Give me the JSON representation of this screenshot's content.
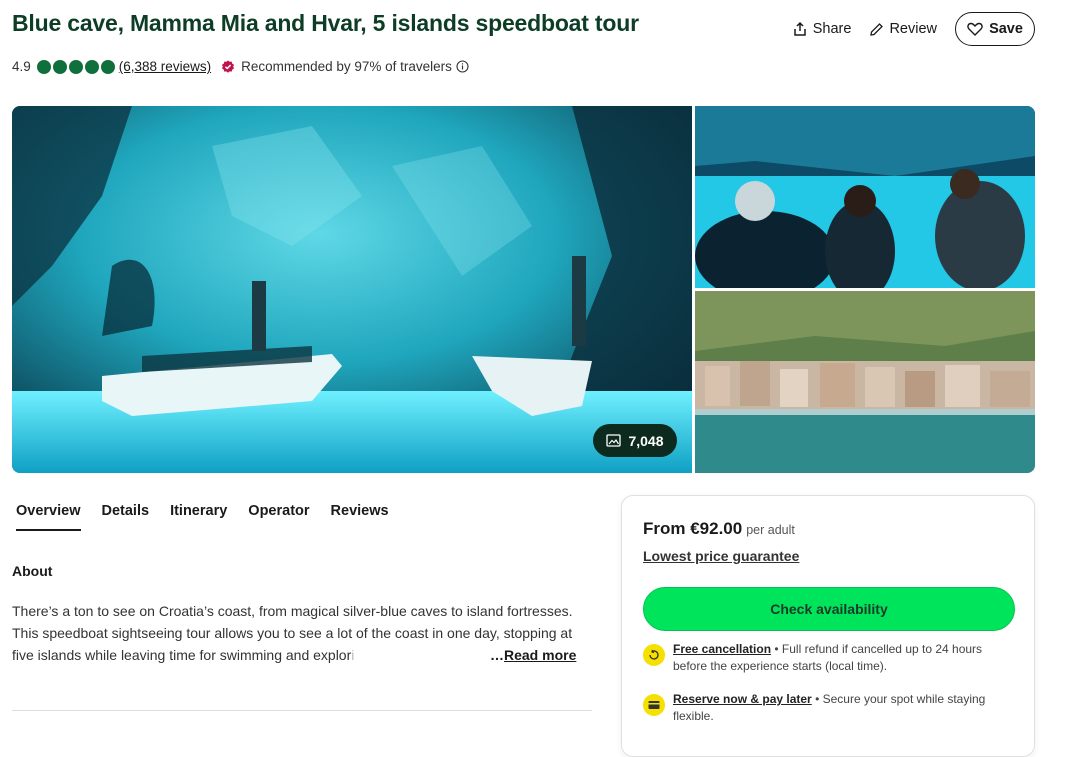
{
  "title": "Blue cave, Mamma Mia and Hvar, 5 islands speedboat tour",
  "rating": {
    "score": "4.9",
    "bubbles": 5,
    "reviews_label": "(6,388 reviews)",
    "recommended": "Recommended by 97% of travelers"
  },
  "actions": {
    "share": "Share",
    "review": "Review",
    "save": "Save"
  },
  "photos": {
    "count": "7,048"
  },
  "tabs": [
    {
      "label": "Overview"
    },
    {
      "label": "Details"
    },
    {
      "label": "Itinerary"
    },
    {
      "label": "Operator"
    },
    {
      "label": "Reviews"
    }
  ],
  "about": {
    "heading": "About",
    "text_main": "There’s a ton to see on Croatia’s coast, from magical silver-blue caves to island fortresses. This speedboat sightseeing tour allows you to see a lot of the coast in one day, stopping at five islands while leaving time for swimming and explor",
    "text_fade": "i",
    "read_more": "Read more"
  },
  "booking": {
    "from": "From €92.00",
    "per": "per adult",
    "guarantee": "Lowest price guarantee",
    "check_label": "Check availability",
    "perks": [
      {
        "title": "Free cancellation",
        "text": " • Full refund if cancelled up to 24 hours before the experience starts (local time)."
      },
      {
        "title": "Reserve now & pay later",
        "text": " • Secure your spot while staying flexible."
      }
    ]
  },
  "colors": {
    "title": "#0d3d24",
    "bubble": "#10703d",
    "cta": "#00e45c",
    "perk_icon": "#f5e000"
  }
}
